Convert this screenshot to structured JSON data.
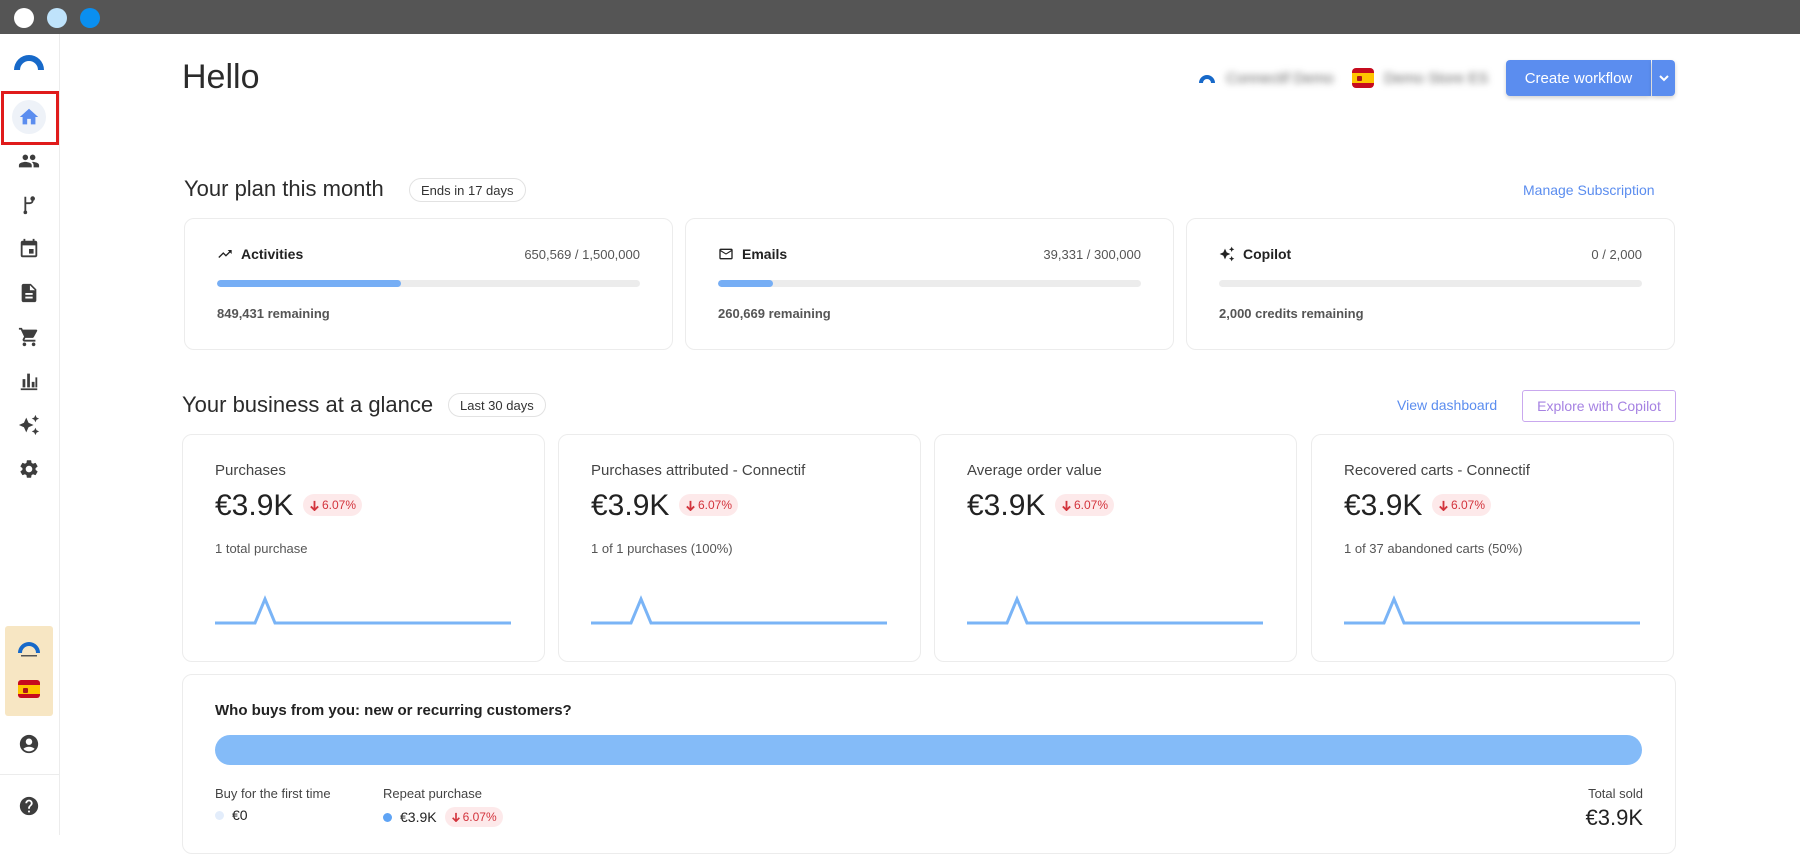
{
  "header": {
    "greeting": "Hello",
    "account_name": "Connectif Demo",
    "store_name": "Demo Store ES",
    "create_button": "Create workflow"
  },
  "sidebar": {
    "items": [
      {
        "icon": "home-icon",
        "active": true
      },
      {
        "icon": "contacts-icon"
      },
      {
        "icon": "workflow-icon"
      },
      {
        "icon": "calendar-icon"
      },
      {
        "icon": "document-icon"
      },
      {
        "icon": "cart-icon"
      },
      {
        "icon": "bar-chart-icon"
      },
      {
        "icon": "sparkle-icon"
      },
      {
        "icon": "gear-icon"
      },
      {
        "icon": "account-icon"
      },
      {
        "icon": "help-icon"
      }
    ]
  },
  "plan": {
    "title": "Your plan this month",
    "badge": "Ends in 17 days",
    "manage_link": "Manage Subscription",
    "cards": [
      {
        "name": "Activities",
        "usage": "650,569 / 1,500,000",
        "remaining": "849,431 remaining",
        "fill": 0.434,
        "icon": "trending-icon"
      },
      {
        "name": "Emails",
        "usage": "39,331 / 300,000",
        "remaining": "260,669 remaining",
        "fill": 0.131,
        "icon": "mail-icon"
      },
      {
        "name": "Copilot",
        "usage": "0 / 2,000",
        "remaining": "2,000 credits remaining",
        "fill": 0.0,
        "icon": "sparkle-icon"
      }
    ]
  },
  "business": {
    "title": "Your business at a glance",
    "badge": "Last 30 days",
    "dashboard_link": "View dashboard",
    "copilot_button": "Explore with Copilot",
    "kpis": [
      {
        "label": "Purchases",
        "value": "€3.9K",
        "change": "6.07%",
        "sub": "1 total purchase"
      },
      {
        "label": "Purchases attributed - Connectif",
        "value": "€3.9K",
        "change": "6.07%",
        "sub": "1 of 1 purchases (100%)"
      },
      {
        "label": "Average order value",
        "value": "€3.9K",
        "change": "6.07%",
        "sub": ""
      },
      {
        "label": "Recovered carts - Connectif",
        "value": "€3.9K",
        "change": "6.07%",
        "sub": "1 of 37 abandoned carts (50%)"
      }
    ]
  },
  "buyers": {
    "title": "Who buys from you: new or recurring customers?",
    "first_label": "Buy for the first time",
    "first_value": "€0",
    "repeat_label": "Repeat purchase",
    "repeat_value": "€3.9K",
    "repeat_change": "6.07%",
    "total_label": "Total sold",
    "total_value": "€3.9K",
    "repeat_share": 1.0
  },
  "colors": {
    "accent": "#5b8def",
    "bar": "#76aef5",
    "negative": "#d3343d",
    "highlight": "#e01b1b"
  }
}
